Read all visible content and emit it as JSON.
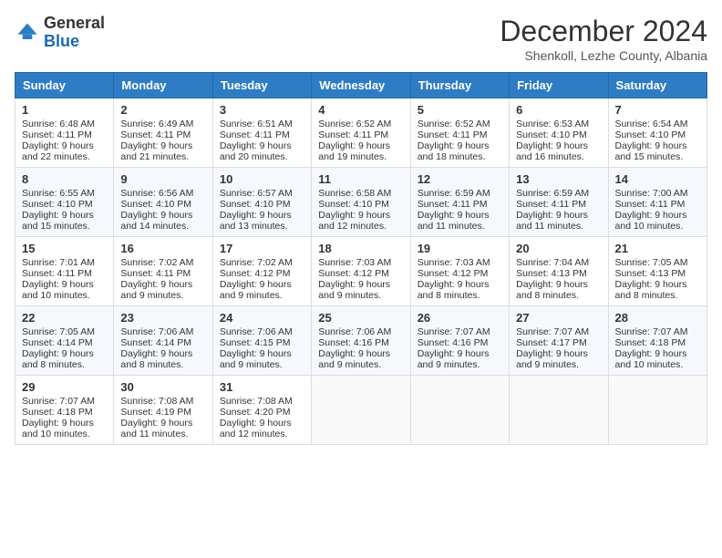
{
  "header": {
    "logo_general": "General",
    "logo_blue": "Blue",
    "month_title": "December 2024",
    "location": "Shenkoll, Lezhe County, Albania"
  },
  "days_of_week": [
    "Sunday",
    "Monday",
    "Tuesday",
    "Wednesday",
    "Thursday",
    "Friday",
    "Saturday"
  ],
  "weeks": [
    [
      {
        "day": "1",
        "sunrise": "6:48 AM",
        "sunset": "4:11 PM",
        "daylight": "9 hours and 22 minutes."
      },
      {
        "day": "2",
        "sunrise": "6:49 AM",
        "sunset": "4:11 PM",
        "daylight": "9 hours and 21 minutes."
      },
      {
        "day": "3",
        "sunrise": "6:51 AM",
        "sunset": "4:11 PM",
        "daylight": "9 hours and 20 minutes."
      },
      {
        "day": "4",
        "sunrise": "6:52 AM",
        "sunset": "4:11 PM",
        "daylight": "9 hours and 19 minutes."
      },
      {
        "day": "5",
        "sunrise": "6:52 AM",
        "sunset": "4:11 PM",
        "daylight": "9 hours and 18 minutes."
      },
      {
        "day": "6",
        "sunrise": "6:53 AM",
        "sunset": "4:10 PM",
        "daylight": "9 hours and 16 minutes."
      },
      {
        "day": "7",
        "sunrise": "6:54 AM",
        "sunset": "4:10 PM",
        "daylight": "9 hours and 15 minutes."
      }
    ],
    [
      {
        "day": "8",
        "sunrise": "6:55 AM",
        "sunset": "4:10 PM",
        "daylight": "9 hours and 15 minutes."
      },
      {
        "day": "9",
        "sunrise": "6:56 AM",
        "sunset": "4:10 PM",
        "daylight": "9 hours and 14 minutes."
      },
      {
        "day": "10",
        "sunrise": "6:57 AM",
        "sunset": "4:10 PM",
        "daylight": "9 hours and 13 minutes."
      },
      {
        "day": "11",
        "sunrise": "6:58 AM",
        "sunset": "4:10 PM",
        "daylight": "9 hours and 12 minutes."
      },
      {
        "day": "12",
        "sunrise": "6:59 AM",
        "sunset": "4:11 PM",
        "daylight": "9 hours and 11 minutes."
      },
      {
        "day": "13",
        "sunrise": "6:59 AM",
        "sunset": "4:11 PM",
        "daylight": "9 hours and 11 minutes."
      },
      {
        "day": "14",
        "sunrise": "7:00 AM",
        "sunset": "4:11 PM",
        "daylight": "9 hours and 10 minutes."
      }
    ],
    [
      {
        "day": "15",
        "sunrise": "7:01 AM",
        "sunset": "4:11 PM",
        "daylight": "9 hours and 10 minutes."
      },
      {
        "day": "16",
        "sunrise": "7:02 AM",
        "sunset": "4:11 PM",
        "daylight": "9 hours and 9 minutes."
      },
      {
        "day": "17",
        "sunrise": "7:02 AM",
        "sunset": "4:12 PM",
        "daylight": "9 hours and 9 minutes."
      },
      {
        "day": "18",
        "sunrise": "7:03 AM",
        "sunset": "4:12 PM",
        "daylight": "9 hours and 9 minutes."
      },
      {
        "day": "19",
        "sunrise": "7:03 AM",
        "sunset": "4:12 PM",
        "daylight": "9 hours and 8 minutes."
      },
      {
        "day": "20",
        "sunrise": "7:04 AM",
        "sunset": "4:13 PM",
        "daylight": "9 hours and 8 minutes."
      },
      {
        "day": "21",
        "sunrise": "7:05 AM",
        "sunset": "4:13 PM",
        "daylight": "9 hours and 8 minutes."
      }
    ],
    [
      {
        "day": "22",
        "sunrise": "7:05 AM",
        "sunset": "4:14 PM",
        "daylight": "9 hours and 8 minutes."
      },
      {
        "day": "23",
        "sunrise": "7:06 AM",
        "sunset": "4:14 PM",
        "daylight": "9 hours and 8 minutes."
      },
      {
        "day": "24",
        "sunrise": "7:06 AM",
        "sunset": "4:15 PM",
        "daylight": "9 hours and 9 minutes."
      },
      {
        "day": "25",
        "sunrise": "7:06 AM",
        "sunset": "4:16 PM",
        "daylight": "9 hours and 9 minutes."
      },
      {
        "day": "26",
        "sunrise": "7:07 AM",
        "sunset": "4:16 PM",
        "daylight": "9 hours and 9 minutes."
      },
      {
        "day": "27",
        "sunrise": "7:07 AM",
        "sunset": "4:17 PM",
        "daylight": "9 hours and 9 minutes."
      },
      {
        "day": "28",
        "sunrise": "7:07 AM",
        "sunset": "4:18 PM",
        "daylight": "9 hours and 10 minutes."
      }
    ],
    [
      {
        "day": "29",
        "sunrise": "7:07 AM",
        "sunset": "4:18 PM",
        "daylight": "9 hours and 10 minutes."
      },
      {
        "day": "30",
        "sunrise": "7:08 AM",
        "sunset": "4:19 PM",
        "daylight": "9 hours and 11 minutes."
      },
      {
        "day": "31",
        "sunrise": "7:08 AM",
        "sunset": "4:20 PM",
        "daylight": "9 hours and 12 minutes."
      },
      null,
      null,
      null,
      null
    ]
  ],
  "labels": {
    "sunrise": "Sunrise:",
    "sunset": "Sunset:",
    "daylight": "Daylight:"
  }
}
